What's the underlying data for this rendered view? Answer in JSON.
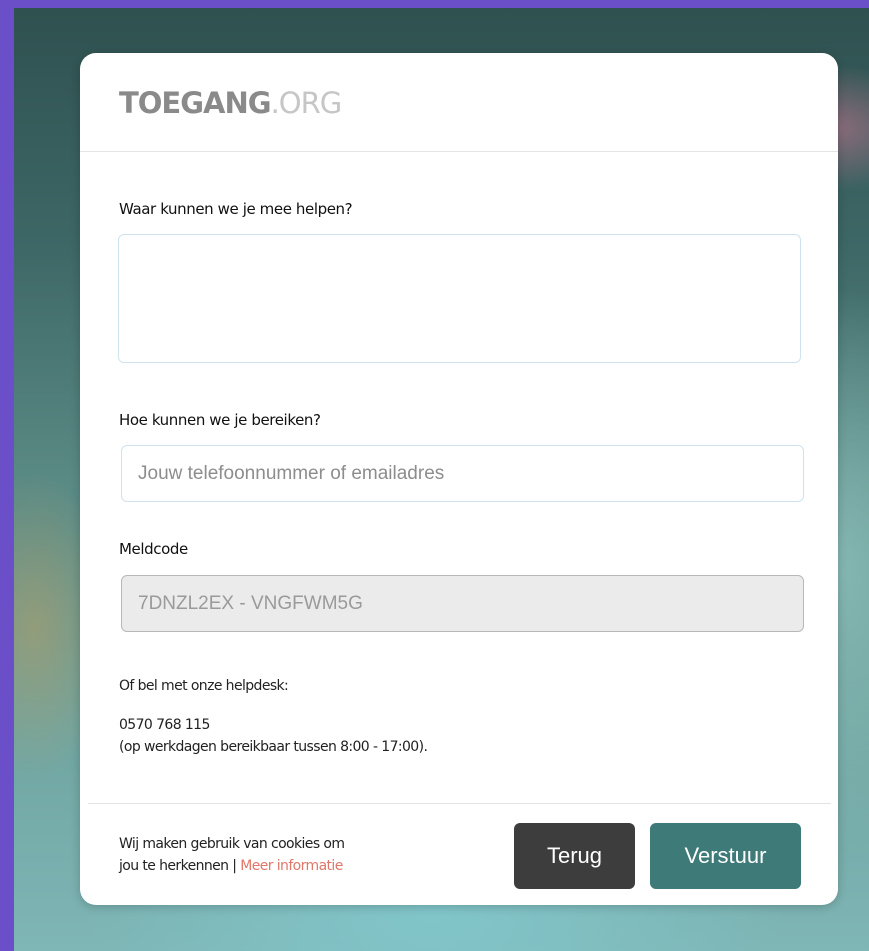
{
  "header": {
    "logo_primary": "TOEGANG",
    "logo_secondary": ".ORG"
  },
  "form": {
    "help_label": "Waar kunnen we je mee helpen?",
    "help_value": "",
    "contact_label": "Hoe kunnen we je bereiken?",
    "contact_placeholder": "Jouw telefoonnummer of emailadres",
    "contact_value": "",
    "code_label": "Meldcode",
    "code_value": "7DNZL2EX - VNGFWM5G"
  },
  "helpdesk": {
    "intro": "Of bel met onze helpdesk:",
    "phone": "0570 768 115",
    "hours": "(op werkdagen bereikbaar tussen 8:00 - 17:00)."
  },
  "footer": {
    "cookie_line1": "Wij maken gebruik van cookies om",
    "cookie_line2": "jou te herkennen | ",
    "cookie_link": "Meer informatie",
    "back_label": "Terug",
    "submit_label": "Verstuur"
  },
  "colors": {
    "page_frame": "#6a4fc9",
    "back_button": "#3d3d3d",
    "submit_button": "#3e7a78",
    "link": "#e0776a"
  }
}
